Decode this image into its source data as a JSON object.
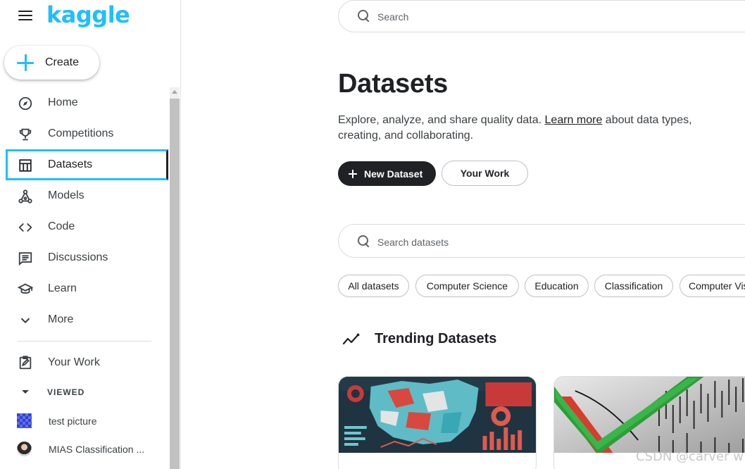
{
  "app": {
    "logo_text": "kaggle",
    "brand_color": "#20beff"
  },
  "sidebar": {
    "create_label": "Create",
    "items": [
      {
        "label": "Home",
        "icon": "compass-icon"
      },
      {
        "label": "Competitions",
        "icon": "trophy-icon"
      },
      {
        "label": "Datasets",
        "icon": "table-icon",
        "active": true
      },
      {
        "label": "Models",
        "icon": "models-icon"
      },
      {
        "label": "Code",
        "icon": "code-icon"
      },
      {
        "label": "Discussions",
        "icon": "discussion-icon"
      },
      {
        "label": "Learn",
        "icon": "graduation-cap-icon"
      },
      {
        "label": "More",
        "icon": "chevron-down-icon"
      }
    ],
    "your_work_label": "Your Work",
    "viewed_header": "VIEWED",
    "viewed_items": [
      {
        "label": "test picture"
      },
      {
        "label": "MIAS Classification ..."
      }
    ]
  },
  "header": {
    "search_placeholder": "Search"
  },
  "main": {
    "title": "Datasets",
    "description_prefix": "Explore, analyze, and share quality data. ",
    "description_link": "Learn more",
    "description_suffix": " about data types, creating, and collaborating.",
    "new_dataset_label": "New Dataset",
    "your_work_label": "Your Work",
    "dataset_search_placeholder": "Search datasets",
    "chips": [
      "All datasets",
      "Computer Science",
      "Education",
      "Classification",
      "Computer Vision"
    ],
    "trending_title": "Trending Datasets"
  },
  "watermark": "CSDN @carver w"
}
